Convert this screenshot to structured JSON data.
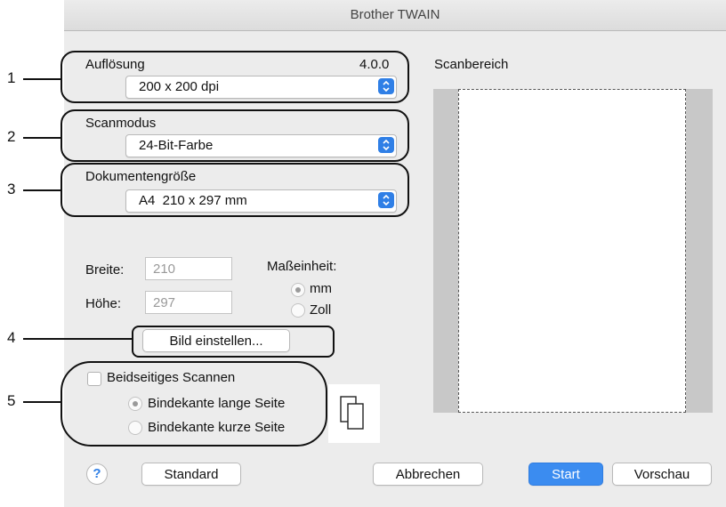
{
  "window": {
    "title": "Brother TWAIN"
  },
  "callout_numbers": [
    "1",
    "2",
    "3",
    "4",
    "5"
  ],
  "resolution": {
    "label": "Auflösung",
    "version": "4.0.0",
    "value": "200 x 200 dpi"
  },
  "scanmode": {
    "label": "Scanmodus",
    "value": "24-Bit-Farbe"
  },
  "docsize": {
    "label": "Dokumentengröße",
    "value": "A4  210 x 297 mm"
  },
  "dimensions": {
    "width_label": "Breite:",
    "width_value": "210",
    "height_label": "Höhe:",
    "height_value": "297",
    "unit_label": "Maßeinheit:",
    "unit_options": [
      "mm",
      "Zoll"
    ],
    "unit_selected": "mm"
  },
  "adjust_button": "Bild einstellen...",
  "duplex": {
    "checkbox_label": "Beidseitiges Scannen",
    "checked": false,
    "options": [
      "Bindekante lange Seite",
      "Bindekante kurze Seite"
    ],
    "selected": "Bindekante lange Seite"
  },
  "scan_area": {
    "label": "Scanbereich"
  },
  "buttons": {
    "help": "?",
    "standard": "Standard",
    "cancel": "Abbrechen",
    "start": "Start",
    "preview": "Vorschau"
  },
  "colors": {
    "accent": "#3b8cf0",
    "window_bg": "#ececec",
    "scan_area_bg": "#c8c8c8"
  }
}
